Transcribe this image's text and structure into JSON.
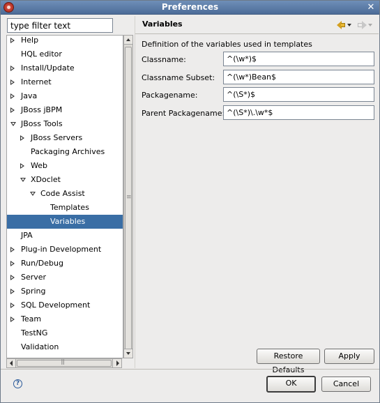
{
  "window": {
    "title": "Preferences"
  },
  "filter": {
    "value": "type filter text"
  },
  "tree": {
    "items": [
      {
        "label": "Help",
        "twisty": "closed",
        "indent": 0
      },
      {
        "label": "HQL editor",
        "twisty": "none",
        "indent": 0
      },
      {
        "label": "Install/Update",
        "twisty": "closed",
        "indent": 0
      },
      {
        "label": "Internet",
        "twisty": "closed",
        "indent": 0
      },
      {
        "label": "Java",
        "twisty": "closed",
        "indent": 0
      },
      {
        "label": "JBoss jBPM",
        "twisty": "closed",
        "indent": 0
      },
      {
        "label": "JBoss Tools",
        "twisty": "open",
        "indent": 0
      },
      {
        "label": "JBoss Servers",
        "twisty": "closed",
        "indent": 1
      },
      {
        "label": "Packaging Archives",
        "twisty": "none",
        "indent": 1
      },
      {
        "label": "Web",
        "twisty": "closed",
        "indent": 1
      },
      {
        "label": "XDoclet",
        "twisty": "open",
        "indent": 1
      },
      {
        "label": "Code Assist",
        "twisty": "open",
        "indent": 2
      },
      {
        "label": "Templates",
        "twisty": "none",
        "indent": 3
      },
      {
        "label": "Variables",
        "twisty": "none",
        "indent": 3,
        "selected": true
      },
      {
        "label": "JPA",
        "twisty": "none",
        "indent": 0
      },
      {
        "label": "Plug-in Development",
        "twisty": "closed",
        "indent": 0
      },
      {
        "label": "Run/Debug",
        "twisty": "closed",
        "indent": 0
      },
      {
        "label": "Server",
        "twisty": "closed",
        "indent": 0
      },
      {
        "label": "Spring",
        "twisty": "closed",
        "indent": 0
      },
      {
        "label": "SQL Development",
        "twisty": "closed",
        "indent": 0
      },
      {
        "label": "Team",
        "twisty": "closed",
        "indent": 0
      },
      {
        "label": "TestNG",
        "twisty": "none",
        "indent": 0
      },
      {
        "label": "Validation",
        "twisty": "none",
        "indent": 0
      }
    ]
  },
  "page": {
    "title": "Variables",
    "description": "Definition of the variables used in templates",
    "fields": [
      {
        "label": "Classname:",
        "value": "^(\\w*)$"
      },
      {
        "label": "Classname Subset:",
        "value": "^(\\w*)Bean$"
      },
      {
        "label": "Packagename:",
        "value": "^(\\S*)$"
      },
      {
        "label": "Parent Packagename:",
        "value": "^(\\S*)\\.\\w*$"
      }
    ]
  },
  "buttons": {
    "restore_defaults": "Restore Defaults",
    "apply": "Apply",
    "ok": "OK",
    "cancel": "Cancel"
  },
  "colors": {
    "selection": "#3a6ea5",
    "titlebar": "#4c6c98"
  }
}
